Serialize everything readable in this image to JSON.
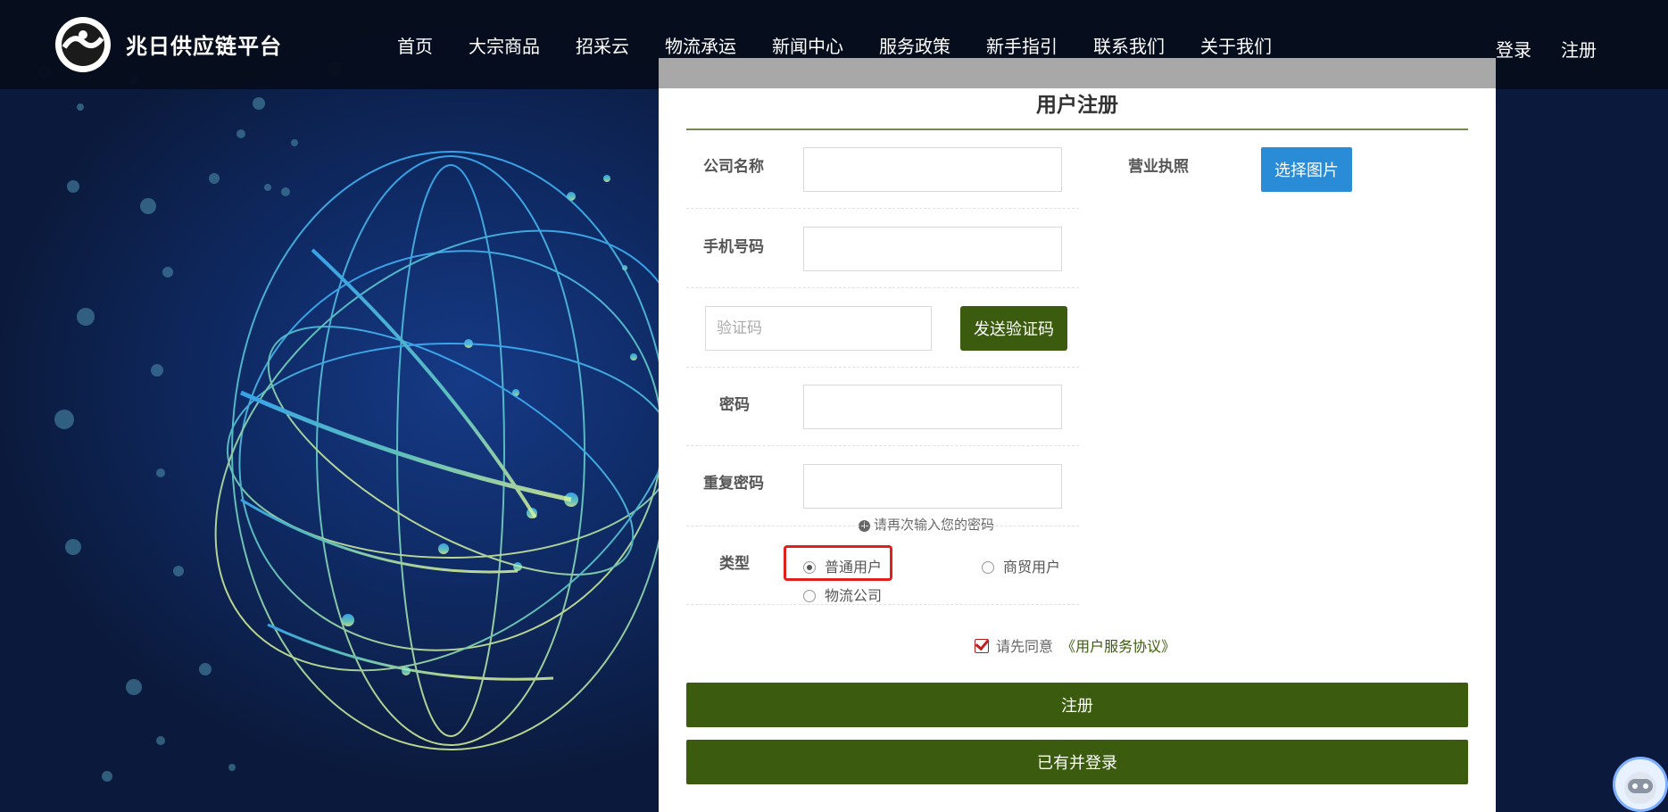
{
  "header": {
    "brand": "兆日供应链平台",
    "nav": [
      "首页",
      "大宗商品",
      "招采云",
      "物流承运",
      "新闻中心",
      "服务政策",
      "新手指引",
      "联系我们",
      "关于我们"
    ],
    "login": "登录",
    "register": "注册"
  },
  "form": {
    "title": "用户注册",
    "company_label": "公司名称",
    "license_label": "营业执照",
    "choose_image": "选择图片",
    "phone_label": "手机号码",
    "code_placeholder": "验证码",
    "send_code": "发送验证码",
    "password_label": "密码",
    "repeat_label": "重复密码",
    "repeat_hint": "请再次输入您的密码",
    "type_label": "类型",
    "types": [
      "普通用户",
      "商贸用户",
      "物流公司"
    ],
    "selected_type": "普通用户",
    "agree_text": "请先同意",
    "agreement_link": "《用户服务协议》",
    "submit": "注册",
    "existing_login": "已有并登录"
  },
  "colors": {
    "primary_green": "#3b5b0f",
    "blue": "#2a8bd6",
    "highlight_red": "#e0201d"
  }
}
